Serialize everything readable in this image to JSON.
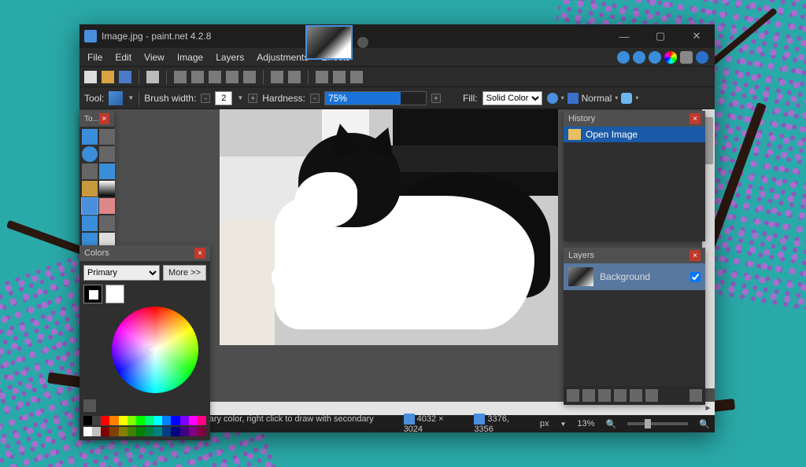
{
  "window": {
    "title": "Image.jpg - paint.net 4.2.8"
  },
  "menus": {
    "file": "File",
    "edit": "Edit",
    "view": "View",
    "image": "Image",
    "layers": "Layers",
    "adjustments": "Adjustments",
    "effects": "Effects"
  },
  "tool_options": {
    "tool_label": "Tool:",
    "brush_width_label": "Brush width:",
    "brush_width_value": "2",
    "hardness_label": "Hardness:",
    "hardness_value": "75%",
    "fill_label": "Fill:",
    "fill_value": "Solid Color",
    "blend_mode": "Normal"
  },
  "panels": {
    "tools_title": "To...",
    "colors_title": "Colors",
    "colors_primary": "Primary",
    "colors_more": "More >>",
    "history_title": "History",
    "history_item0": "Open Image",
    "layers_title": "Layers",
    "layer0_name": "Background"
  },
  "statusbar": {
    "hint": "Left click to draw with primary color, right click to draw with secondary color.",
    "dims": "4032 × 3024",
    "cursor": "3376, 3356",
    "unit": "px",
    "zoom": "13%"
  },
  "palette_top": [
    "#000",
    "#404040",
    "#ff0000",
    "#ff8000",
    "#ffff00",
    "#80ff00",
    "#00ff00",
    "#00ff80",
    "#00ffff",
    "#0080ff",
    "#0000ff",
    "#8000ff",
    "#ff00ff",
    "#ff0080"
  ],
  "palette_bottom": [
    "#fff",
    "#c0c0c0",
    "#800000",
    "#804000",
    "#808000",
    "#408000",
    "#008000",
    "#008040",
    "#008080",
    "#004080",
    "#000080",
    "#400080",
    "#800080",
    "#800040"
  ]
}
